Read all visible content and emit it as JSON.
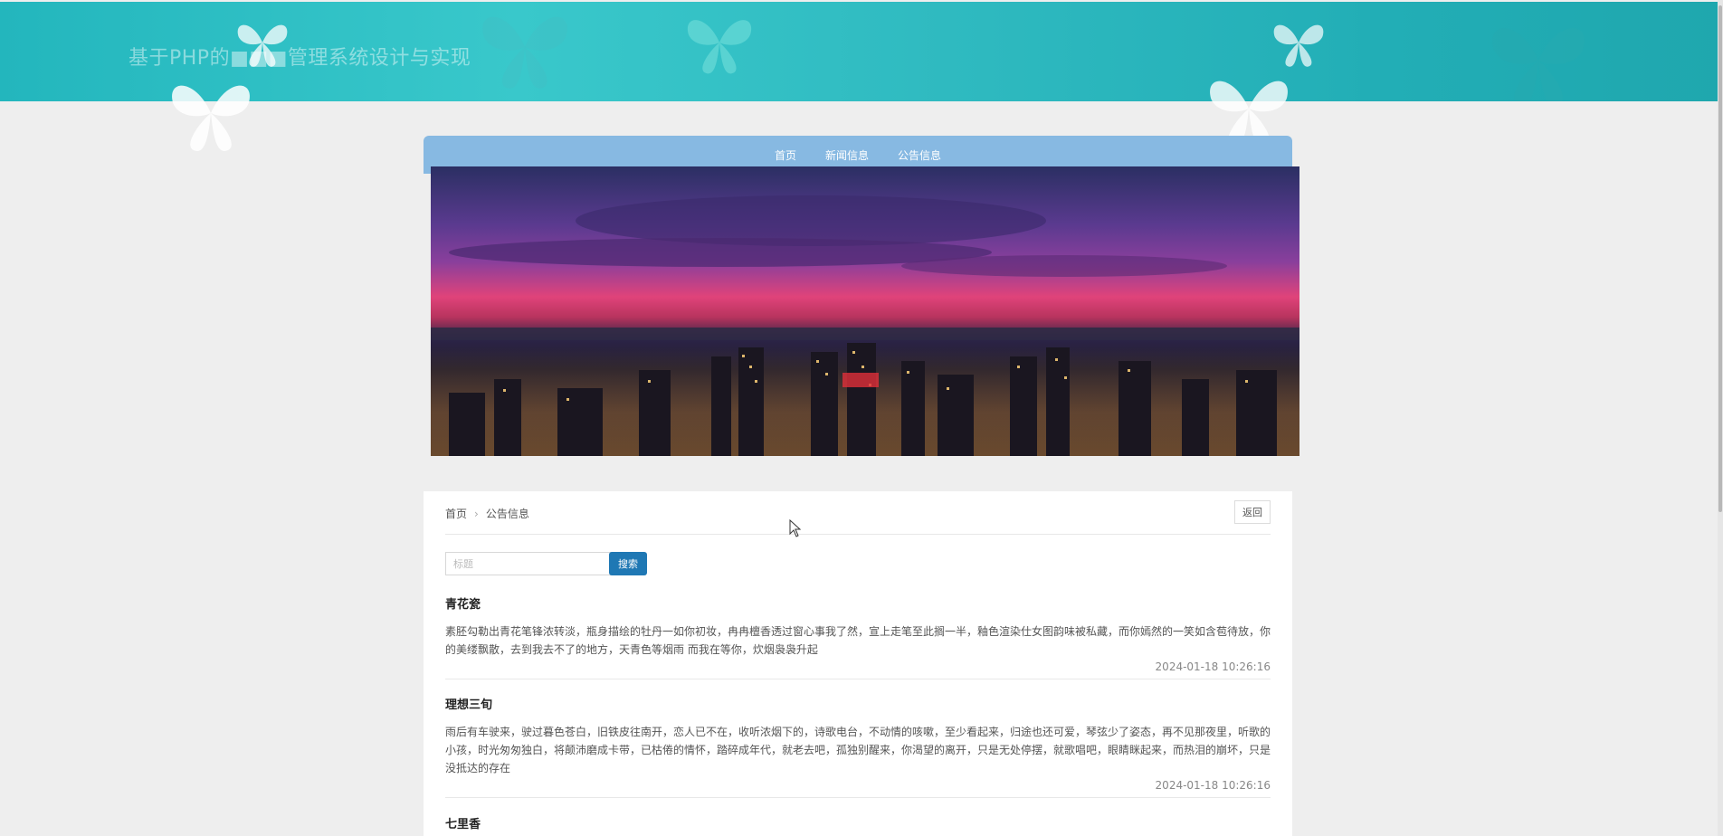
{
  "header": {
    "title": "基于PHP的■■■管理系统设计与实现"
  },
  "nav": {
    "items": [
      "首页",
      "新闻信息",
      "公告信息"
    ]
  },
  "breadcrumb": {
    "home": "首页",
    "current": "公告信息"
  },
  "back_label": "返回",
  "search": {
    "placeholder": "标题",
    "button_label": "搜索"
  },
  "notices": [
    {
      "title": "青花瓷",
      "content": "素胚勾勒出青花笔锋浓转淡，瓶身描绘的牡丹一如你初妆，冉冉檀香透过窗心事我了然，宣上走笔至此搁一半，釉色渲染仕女图韵味被私藏，而你嫣然的一笑如含苞待放，你的美缕飘散，去到我去不了的地方，天青色等烟雨 而我在等你，炊烟袅袅升起",
      "date": "2024-01-18 10:26:16"
    },
    {
      "title": "理想三旬",
      "content": "雨后有车驶来，驶过暮色苍白，旧铁皮往南开，恋人已不在，收听浓烟下的，诗歌电台，不动情的咳嗽，至少看起来，归途也还可爱，琴弦少了姿态，再不见那夜里，听歌的小孩，时光匆匆独白，将颠沛磨成卡带，已枯倦的情怀，踏碎成年代，就老去吧，孤独别醒来，你渴望的离开，只是无处停摆，就歌唱吧，眼睛眯起来，而热泪的崩坏，只是没抵达的存在",
      "date": "2024-01-18 10:26:16"
    },
    {
      "title": "七里香",
      "content": "",
      "date": ""
    }
  ],
  "icons": {
    "butterfly": "butterfly-icon",
    "cursor": "mouse-cursor-icon"
  },
  "colors": {
    "header": "#2fbac0",
    "nav": "#87b9e2",
    "search_button": "#1f78b4"
  }
}
